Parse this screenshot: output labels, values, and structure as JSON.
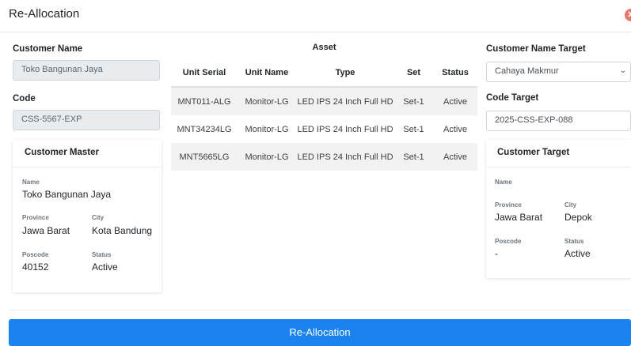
{
  "header": {
    "title": "Re-Allocation",
    "close_glyph": "✕"
  },
  "source": {
    "customer_name_label": "Customer Name",
    "customer_name_value": "Toko Bangunan Jaya",
    "code_label": "Code",
    "code_value": "CSS-5567-EXP",
    "card": {
      "title": "Customer Master",
      "name_label": "Name",
      "name_value": "Toko Bangunan Jaya",
      "province_label": "Province",
      "province_value": "Jawa Barat",
      "city_label": "City",
      "city_value": "Kota Bandung",
      "poscode_label": "Poscode",
      "poscode_value": "40152",
      "status_label": "Status",
      "status_value": "Active"
    }
  },
  "asset": {
    "title": "Asset",
    "columns": [
      "Unit Serial",
      "Unit Name",
      "Type",
      "Set",
      "Status"
    ],
    "rows": [
      [
        "MNT011-ALG",
        "Monitor-LG",
        "LED IPS 24 Inch Full HD",
        "Set-1",
        "Active"
      ],
      [
        "MNT34234LG",
        "Monitor-LG",
        "LED IPS 24 Inch Full HD",
        "Set-1",
        "Active"
      ],
      [
        "MNT5665LG",
        "Monitor-LG",
        "LED IPS 24 Inch Full HD",
        "Set-1",
        "Active"
      ]
    ]
  },
  "target": {
    "customer_name_label": "Customer Name Target",
    "customer_name_value": "Cahaya Makmur",
    "code_label": "Code Target",
    "code_value": "2025-CSS-EXP-088",
    "card": {
      "title": "Customer Target",
      "name_label": "Name",
      "name_value": "",
      "province_label": "Province",
      "province_value": "Jawa Barat",
      "city_label": "City",
      "city_value": "Depok",
      "poscode_label": "Poscode",
      "poscode_value": "-",
      "status_label": "Status",
      "status_value": "Active"
    }
  },
  "footer": {
    "submit_label": "Re-Allocation"
  },
  "colors": {
    "primary": "#1a83ef",
    "close": "#e8776f",
    "readonly_bg": "#e9ecef"
  },
  "icons": {
    "close": "close-icon",
    "select": "chevron-down-icon"
  }
}
